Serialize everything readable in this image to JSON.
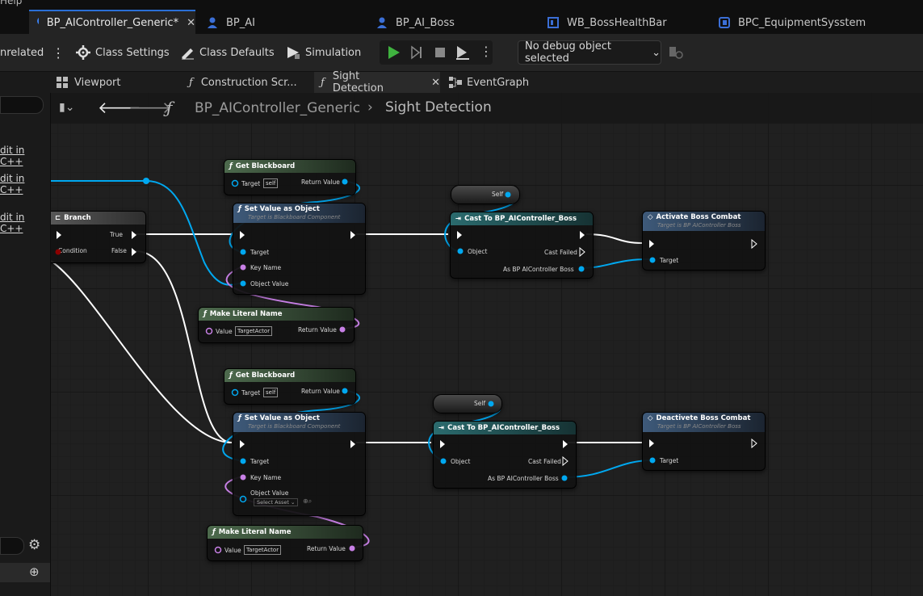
{
  "menu": {
    "help": "Help"
  },
  "tabs": [
    {
      "label": "BP_AIController_Generic*",
      "active": true
    },
    {
      "label": "BP_AI"
    },
    {
      "label": "BP_AI_Boss"
    },
    {
      "label": "WB_BossHealthBar"
    },
    {
      "label": "BPC_EquipmentSysstem"
    }
  ],
  "toolbar": {
    "unrelated": "nrelated",
    "class_settings": "Class Settings",
    "class_defaults": "Class Defaults",
    "simulation": "Simulation",
    "debug_object": "No debug object selected"
  },
  "subtabs": {
    "viewport": "Viewport",
    "construction": "Construction Scr...",
    "sight": "Sight Detection",
    "eventgraph": "EventGraph"
  },
  "breadcrumb": {
    "blueprint": "BP_AIController_Generic",
    "graph": "Sight Detection"
  },
  "left_panel": {
    "edit_cpp": "dit in C++"
  },
  "nodes": {
    "branch": {
      "title": "Branch",
      "true": "True",
      "false": "False",
      "condition": "Condition"
    },
    "get_blackboard": {
      "title": "Get Blackboard",
      "target": "Target",
      "self": "self",
      "return": "Return Value"
    },
    "set_value": {
      "title": "Set Value as Object",
      "subtitle": "Target is Blackboard Component",
      "target": "Target",
      "key": "Key Name",
      "obj": "Object Value",
      "select_asset": "Select Asset"
    },
    "literal": {
      "title": "Make Literal Name",
      "value": "Value",
      "value_text": "TargetActor",
      "return": "Return Value"
    },
    "self": {
      "label": "Self"
    },
    "cast": {
      "title": "Cast To BP_AIController_Boss",
      "object": "Object",
      "failed": "Cast Failed",
      "as": "As BP AIController Boss"
    },
    "activate": {
      "title": "Activate Boss Combat",
      "subtitle": "Target is BP AIController Boss",
      "target": "Target"
    },
    "deactivate": {
      "title": "Deactivete Boss Combat",
      "subtitle": "Target is BP AIController Boss",
      "target": "Target"
    }
  },
  "colors": {
    "exec": "#ffffff",
    "object": "#00a8f0",
    "name": "#c880e6",
    "bool": "#8c0000",
    "function_header": "#3c5a3c",
    "cast_header": "#1e5a5a",
    "event_header": "#3a5a7a"
  }
}
